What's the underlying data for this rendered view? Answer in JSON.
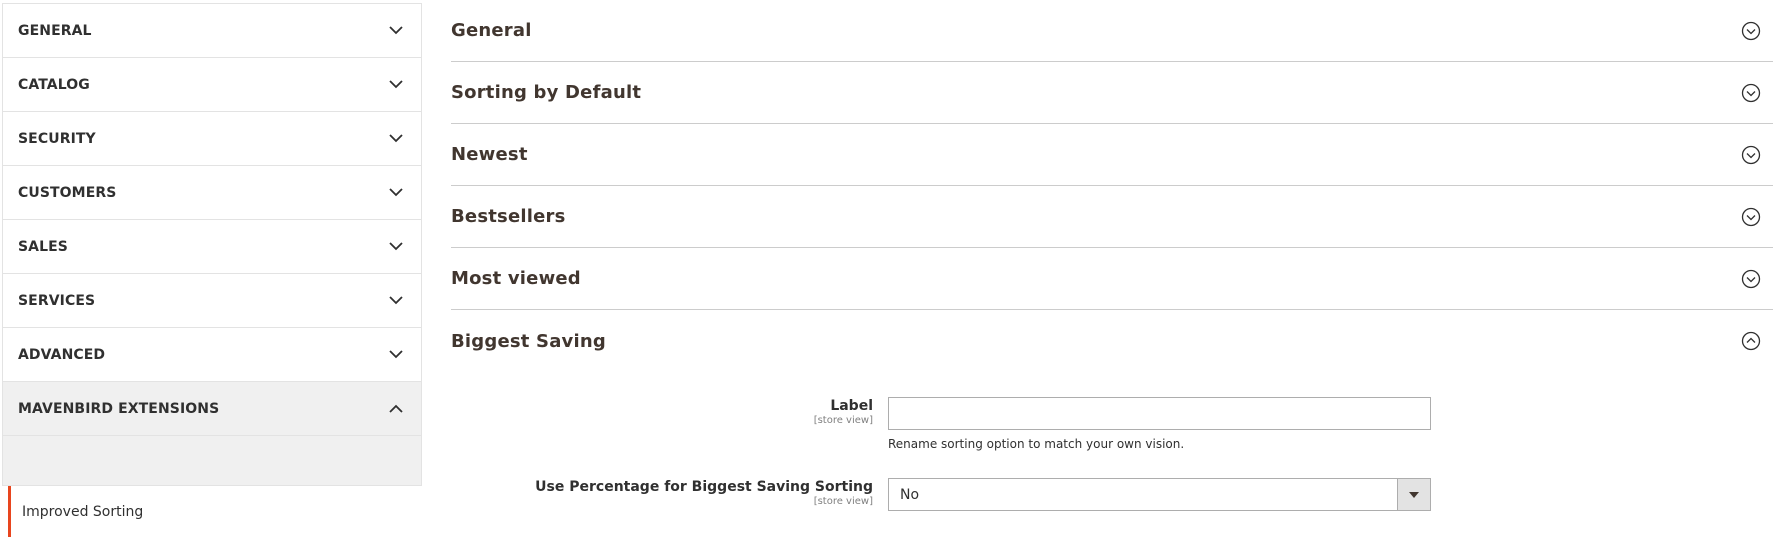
{
  "sidebar": {
    "items": [
      {
        "label": "GENERAL",
        "icon": "chevron-down-icon"
      },
      {
        "label": "CATALOG",
        "icon": "chevron-down-icon"
      },
      {
        "label": "SECURITY",
        "icon": "chevron-down-icon"
      },
      {
        "label": "CUSTOMERS",
        "icon": "chevron-down-icon"
      },
      {
        "label": "SALES",
        "icon": "chevron-down-icon"
      },
      {
        "label": "SERVICES",
        "icon": "chevron-down-icon"
      },
      {
        "label": "ADVANCED",
        "icon": "chevron-down-icon"
      },
      {
        "label": "MAVENBIRD EXTENSIONS",
        "icon": "chevron-up-icon",
        "expanded": true
      }
    ],
    "sub_items": [
      {
        "label": "Improved Sorting",
        "active": true
      }
    ],
    "accent_color": "#e8451e"
  },
  "sections": [
    {
      "title": "General",
      "expanded": false
    },
    {
      "title": "Sorting by Default",
      "expanded": false
    },
    {
      "title": "Newest",
      "expanded": false
    },
    {
      "title": "Bestsellers",
      "expanded": false
    },
    {
      "title": "Most viewed",
      "expanded": false
    },
    {
      "title": "Biggest Saving",
      "expanded": true
    }
  ],
  "biggest_saving": {
    "label_field": {
      "label": "Label",
      "scope": "[store view]",
      "value": "",
      "note": "Rename sorting option to match your own vision."
    },
    "percentage_field": {
      "label": "Use Percentage for Biggest Saving Sorting",
      "scope": "[store view]",
      "selected": "No"
    }
  }
}
